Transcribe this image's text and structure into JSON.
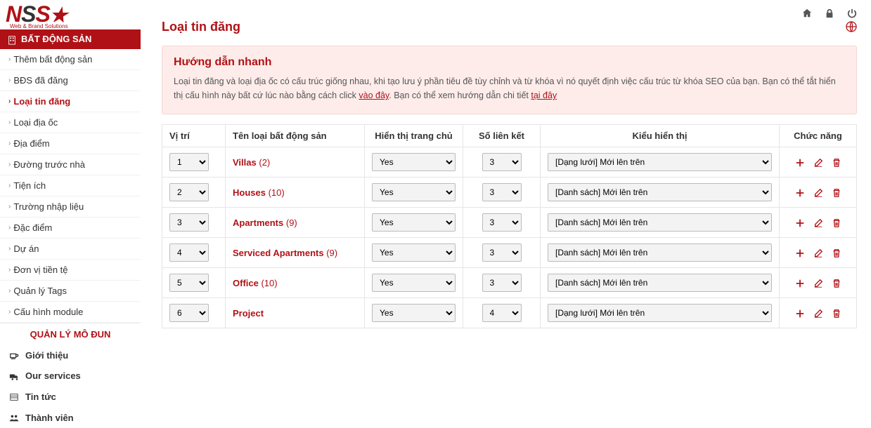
{
  "logo": {
    "subtitle": "Web & Brand Solutions"
  },
  "sidebar": {
    "section1_title": "BẤT ĐỘNG SẢN",
    "items": [
      "Thêm bất động sản",
      "BĐS đã đăng",
      "Loại tin đăng",
      "Loại địa ốc",
      "Địa điểm",
      "Đường trước nhà",
      "Tiện ích",
      "Trường nhập liệu",
      "Đặc điểm",
      "Dự án",
      "Đơn vị tiền tệ",
      "Quản lý Tags",
      "Cấu hình module"
    ],
    "active_index": 2,
    "section2_title": "QUẢN LÝ MÔ ĐUN",
    "modules": [
      "Giới thiệu",
      "Our services",
      "Tin tức",
      "Thành viên"
    ]
  },
  "page": {
    "title": "Loại tin đăng",
    "info_title": "Hướng dẫn nhanh",
    "info_text_1": "Loại tin đăng và loại địa ốc có cấu trúc giống nhau, khi tạo lưu ý phần tiêu đề tùy chỉnh và từ khóa vì nó quyết định việc cấu trúc từ khóa SEO của bạn. Bạn có thể tắt hiển thị cấu hình này bất cứ lúc nào bằng cách click ",
    "info_link_1": "vào đây",
    "info_text_2": ". Bạn có thể xem hướng dẫn chi tiết ",
    "info_link_2": "tại đây"
  },
  "table": {
    "headers": [
      "Vị trí",
      "Tên loại bất động sản",
      "Hiển thị trang chủ",
      "Số liên kết",
      "Kiểu hiển thị",
      "Chức năng"
    ],
    "rows": [
      {
        "pos": "1",
        "name": "Villas",
        "count": "(2)",
        "show": "Yes",
        "links": "3",
        "style": "[Dạng lưới] Mới lên trên"
      },
      {
        "pos": "2",
        "name": "Houses",
        "count": "(10)",
        "show": "Yes",
        "links": "3",
        "style": "[Danh sách] Mới lên trên"
      },
      {
        "pos": "3",
        "name": "Apartments",
        "count": "(9)",
        "show": "Yes",
        "links": "3",
        "style": "[Danh sách] Mới lên trên"
      },
      {
        "pos": "4",
        "name": "Serviced Apartments",
        "count": "(9)",
        "show": "Yes",
        "links": "3",
        "style": "[Danh sách] Mới lên trên"
      },
      {
        "pos": "5",
        "name": "Office",
        "count": "(10)",
        "show": "Yes",
        "links": "3",
        "style": "[Danh sách] Mới lên trên"
      },
      {
        "pos": "6",
        "name": "Project",
        "count": "",
        "show": "Yes",
        "links": "4",
        "style": "[Dạng lưới] Mới lên trên"
      }
    ]
  }
}
